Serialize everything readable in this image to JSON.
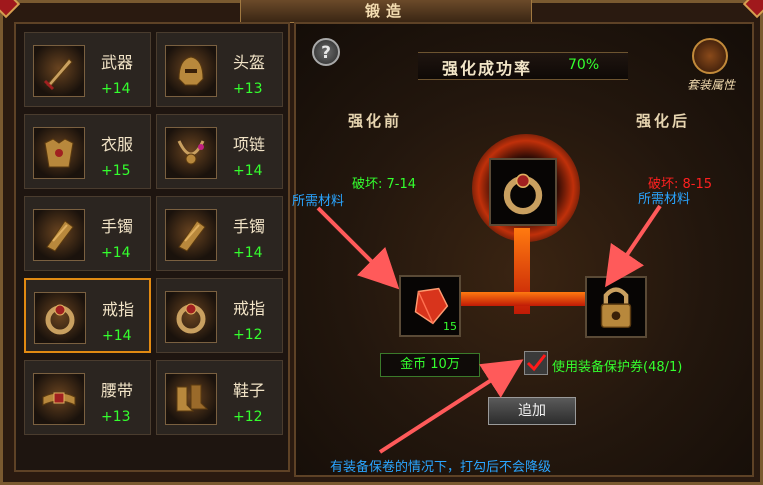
{
  "window": {
    "title": "锻造"
  },
  "slots": [
    {
      "name": "武器",
      "level": "+14",
      "icon": "sword-icon",
      "selected": false
    },
    {
      "name": "头盔",
      "level": "+13",
      "icon": "helmet-icon",
      "selected": false
    },
    {
      "name": "衣服",
      "level": "+15",
      "icon": "armor-icon",
      "selected": false
    },
    {
      "name": "项链",
      "level": "+14",
      "icon": "necklace-icon",
      "selected": false
    },
    {
      "name": "手镯",
      "level": "+14",
      "icon": "bracelet-icon",
      "selected": false
    },
    {
      "name": "手镯",
      "level": "+14",
      "icon": "bracelet-icon",
      "selected": false
    },
    {
      "name": "戒指",
      "level": "+14",
      "icon": "ring-icon",
      "selected": true
    },
    {
      "name": "戒指",
      "level": "+12",
      "icon": "ring-icon",
      "selected": false
    },
    {
      "name": "腰带",
      "level": "+13",
      "icon": "belt-icon",
      "selected": false
    },
    {
      "name": "鞋子",
      "level": "+12",
      "icon": "boots-icon",
      "selected": false
    }
  ],
  "forge": {
    "help_label": "?",
    "rate_label": "强化成功率",
    "rate_value": "70%",
    "set_label": "套装属性",
    "before_label": "强化前",
    "after_label": "强化后",
    "before_stat": "破坏: 7-14",
    "after_stat": "破坏: 8-15",
    "material_count": "15",
    "gold_label": "金币 10万",
    "protect_label": "使用装备保护券(48/1)",
    "protect_checked": true,
    "add_label": "追加"
  },
  "annotations": {
    "left_material": "所需材料",
    "right_material": "所需材料",
    "bottom": "有装备保卷的情况下，打勾后不会降级"
  },
  "colors": {
    "green": "#34ff2e",
    "red": "#ff2020",
    "blue_note": "#2aa5ff",
    "select": "#e28a12"
  }
}
